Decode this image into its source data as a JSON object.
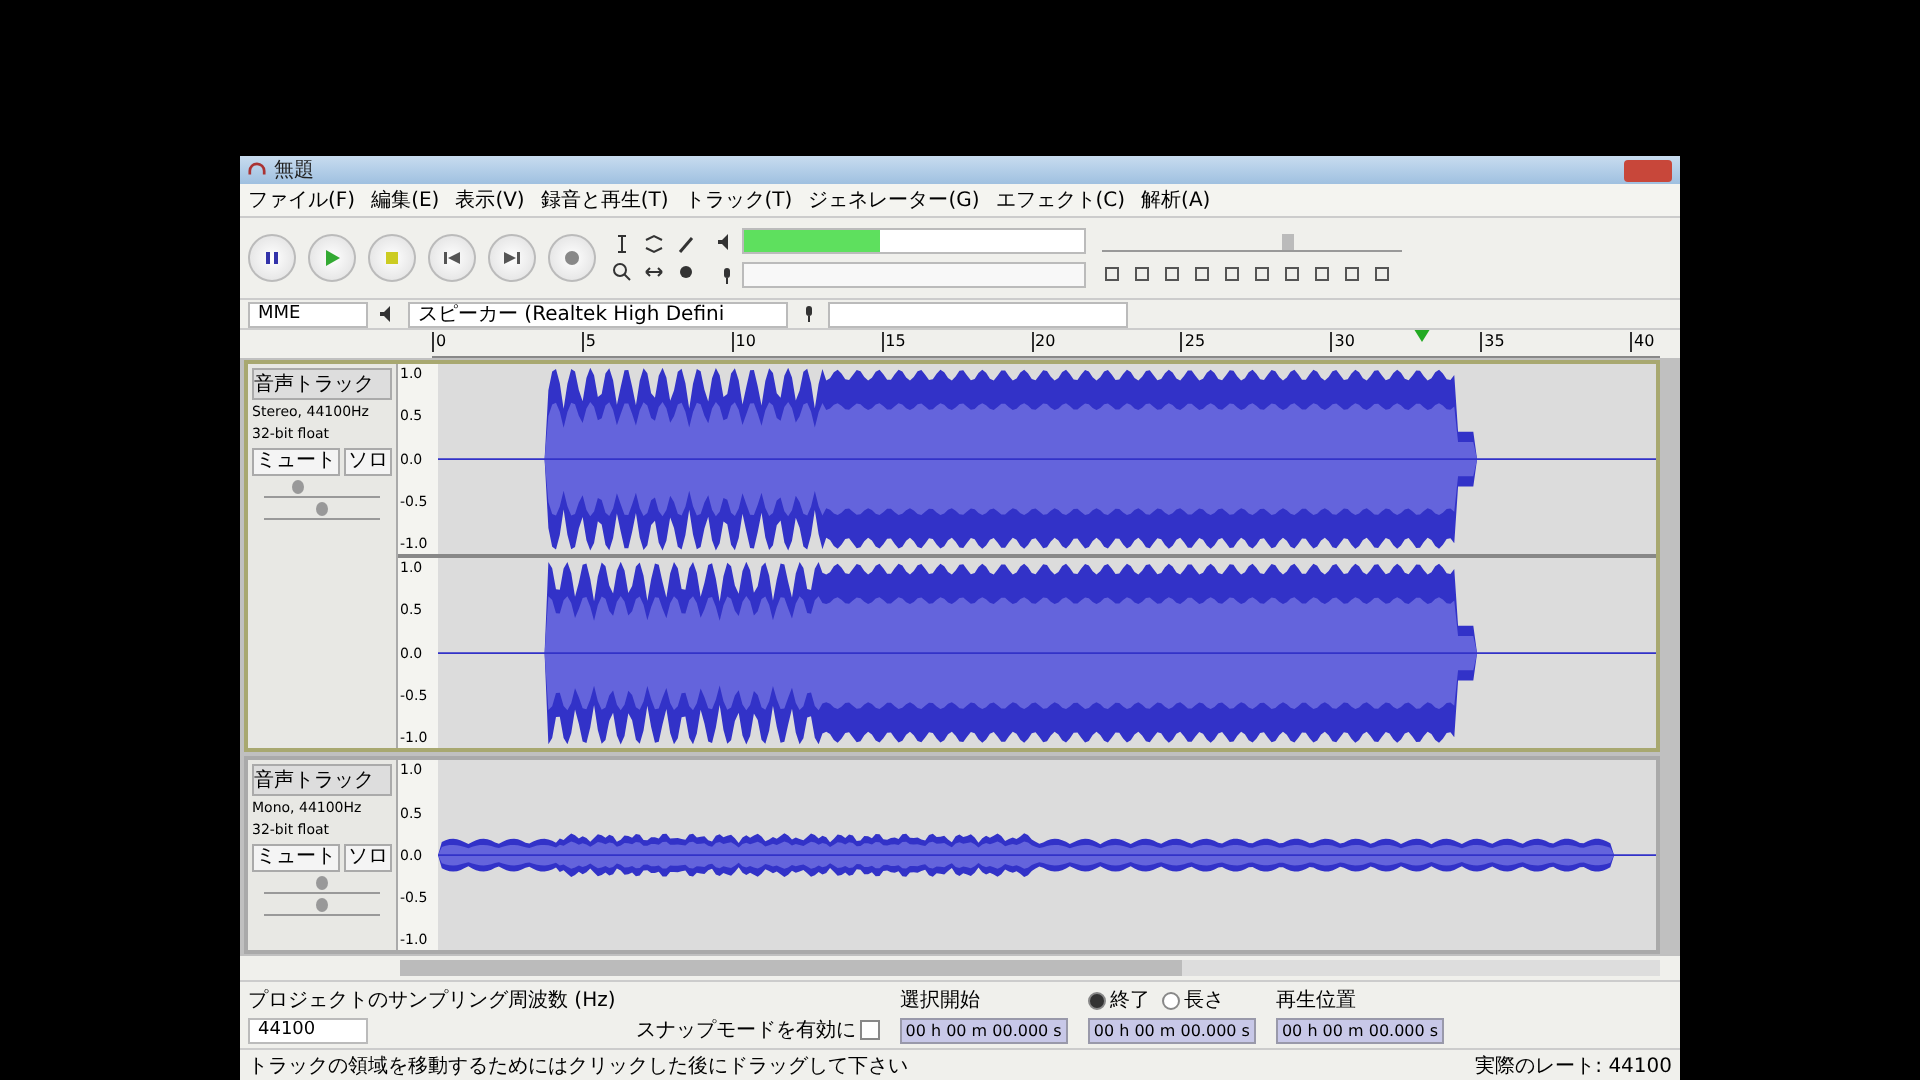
{
  "window": {
    "title": "無題"
  },
  "menu": [
    "ファイル(F)",
    "編集(E)",
    "表示(V)",
    "録音と再生(T)",
    "トラック(T)",
    "ジェネレーター(G)",
    "エフェクト(C)",
    "解析(A)"
  ],
  "output_volume": {
    "level": 0.6
  },
  "transport": [
    {
      "kind": "pause"
    },
    {
      "kind": "play"
    },
    {
      "kind": "stop"
    },
    {
      "kind": "start"
    },
    {
      "kind": "end"
    },
    {
      "kind": "record"
    }
  ],
  "device_bar": {
    "host": "MME",
    "output": "スピーカー (Realtek High Defini"
  },
  "ruler_ticks": [
    "0",
    "5",
    "10",
    "15",
    "20",
    "25",
    "30",
    "35",
    "40"
  ],
  "tracks": [
    {
      "name": "音声トラック",
      "format": "Stereo, 44100Hz",
      "depth": "32-bit float",
      "mute": "ミュート",
      "solo": "ソロ",
      "selected": true,
      "kind": "stereo",
      "gain": {
        "level": 0.3
      },
      "pan": {
        "level": 0.5
      },
      "channels": [
        {
          "scale": [
            "1.0",
            "0.5",
            "0.0",
            "-0.5",
            "-1.0"
          ]
        },
        {
          "scale": [
            "1.0",
            "0.5",
            "0.0",
            "-0.5",
            "-1.0"
          ]
        }
      ]
    },
    {
      "name": "音声トラック",
      "format": "Mono, 44100Hz",
      "depth": "32-bit float",
      "mute": "ミュート",
      "solo": "ソロ",
      "selected": false,
      "kind": "mono",
      "gain": {
        "level": 0.5
      },
      "pan": {
        "level": 0.5
      },
      "channels": [
        {
          "scale": [
            "1.0",
            "0.5",
            "0.0",
            "-0.5",
            "-1.0"
          ]
        }
      ]
    }
  ],
  "selection_bar": {
    "rate_label": "プロジェクトのサンプリング周波数 (Hz)",
    "rate": "44100",
    "snap_label": "スナップモードを有効に",
    "snap_checked": false,
    "start_label": "選択開始",
    "start": "00 h 00 m 00.000 s",
    "end_modes": [
      {
        "label": "終了",
        "selected": true
      },
      {
        "label": "長さ",
        "selected": false
      }
    ],
    "end": "00 h 00 m 00.000 s",
    "pos_label": "再生位置",
    "pos": "00 h 00 m 00.000 s"
  },
  "status_bar": {
    "message": "トラックの領域を移動するためにはクリックした後にドラッグして下さい",
    "rate": "実際のレート: 44100"
  }
}
